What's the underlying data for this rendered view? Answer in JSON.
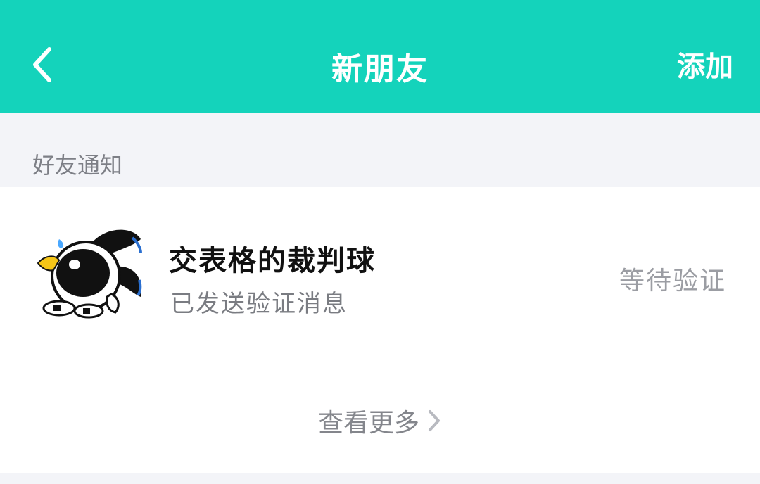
{
  "header": {
    "title": "新朋友",
    "add_label": "添加",
    "background_color": "#14d3bb"
  },
  "section": {
    "title": "好友通知"
  },
  "friend_request": {
    "name": "交表格的裁判球",
    "message": "已发送验证消息",
    "status": "等待验证",
    "avatar_icon": "cartoon-character-avatar"
  },
  "more": {
    "label": "查看更多",
    "icon": "chevron-right-icon"
  }
}
